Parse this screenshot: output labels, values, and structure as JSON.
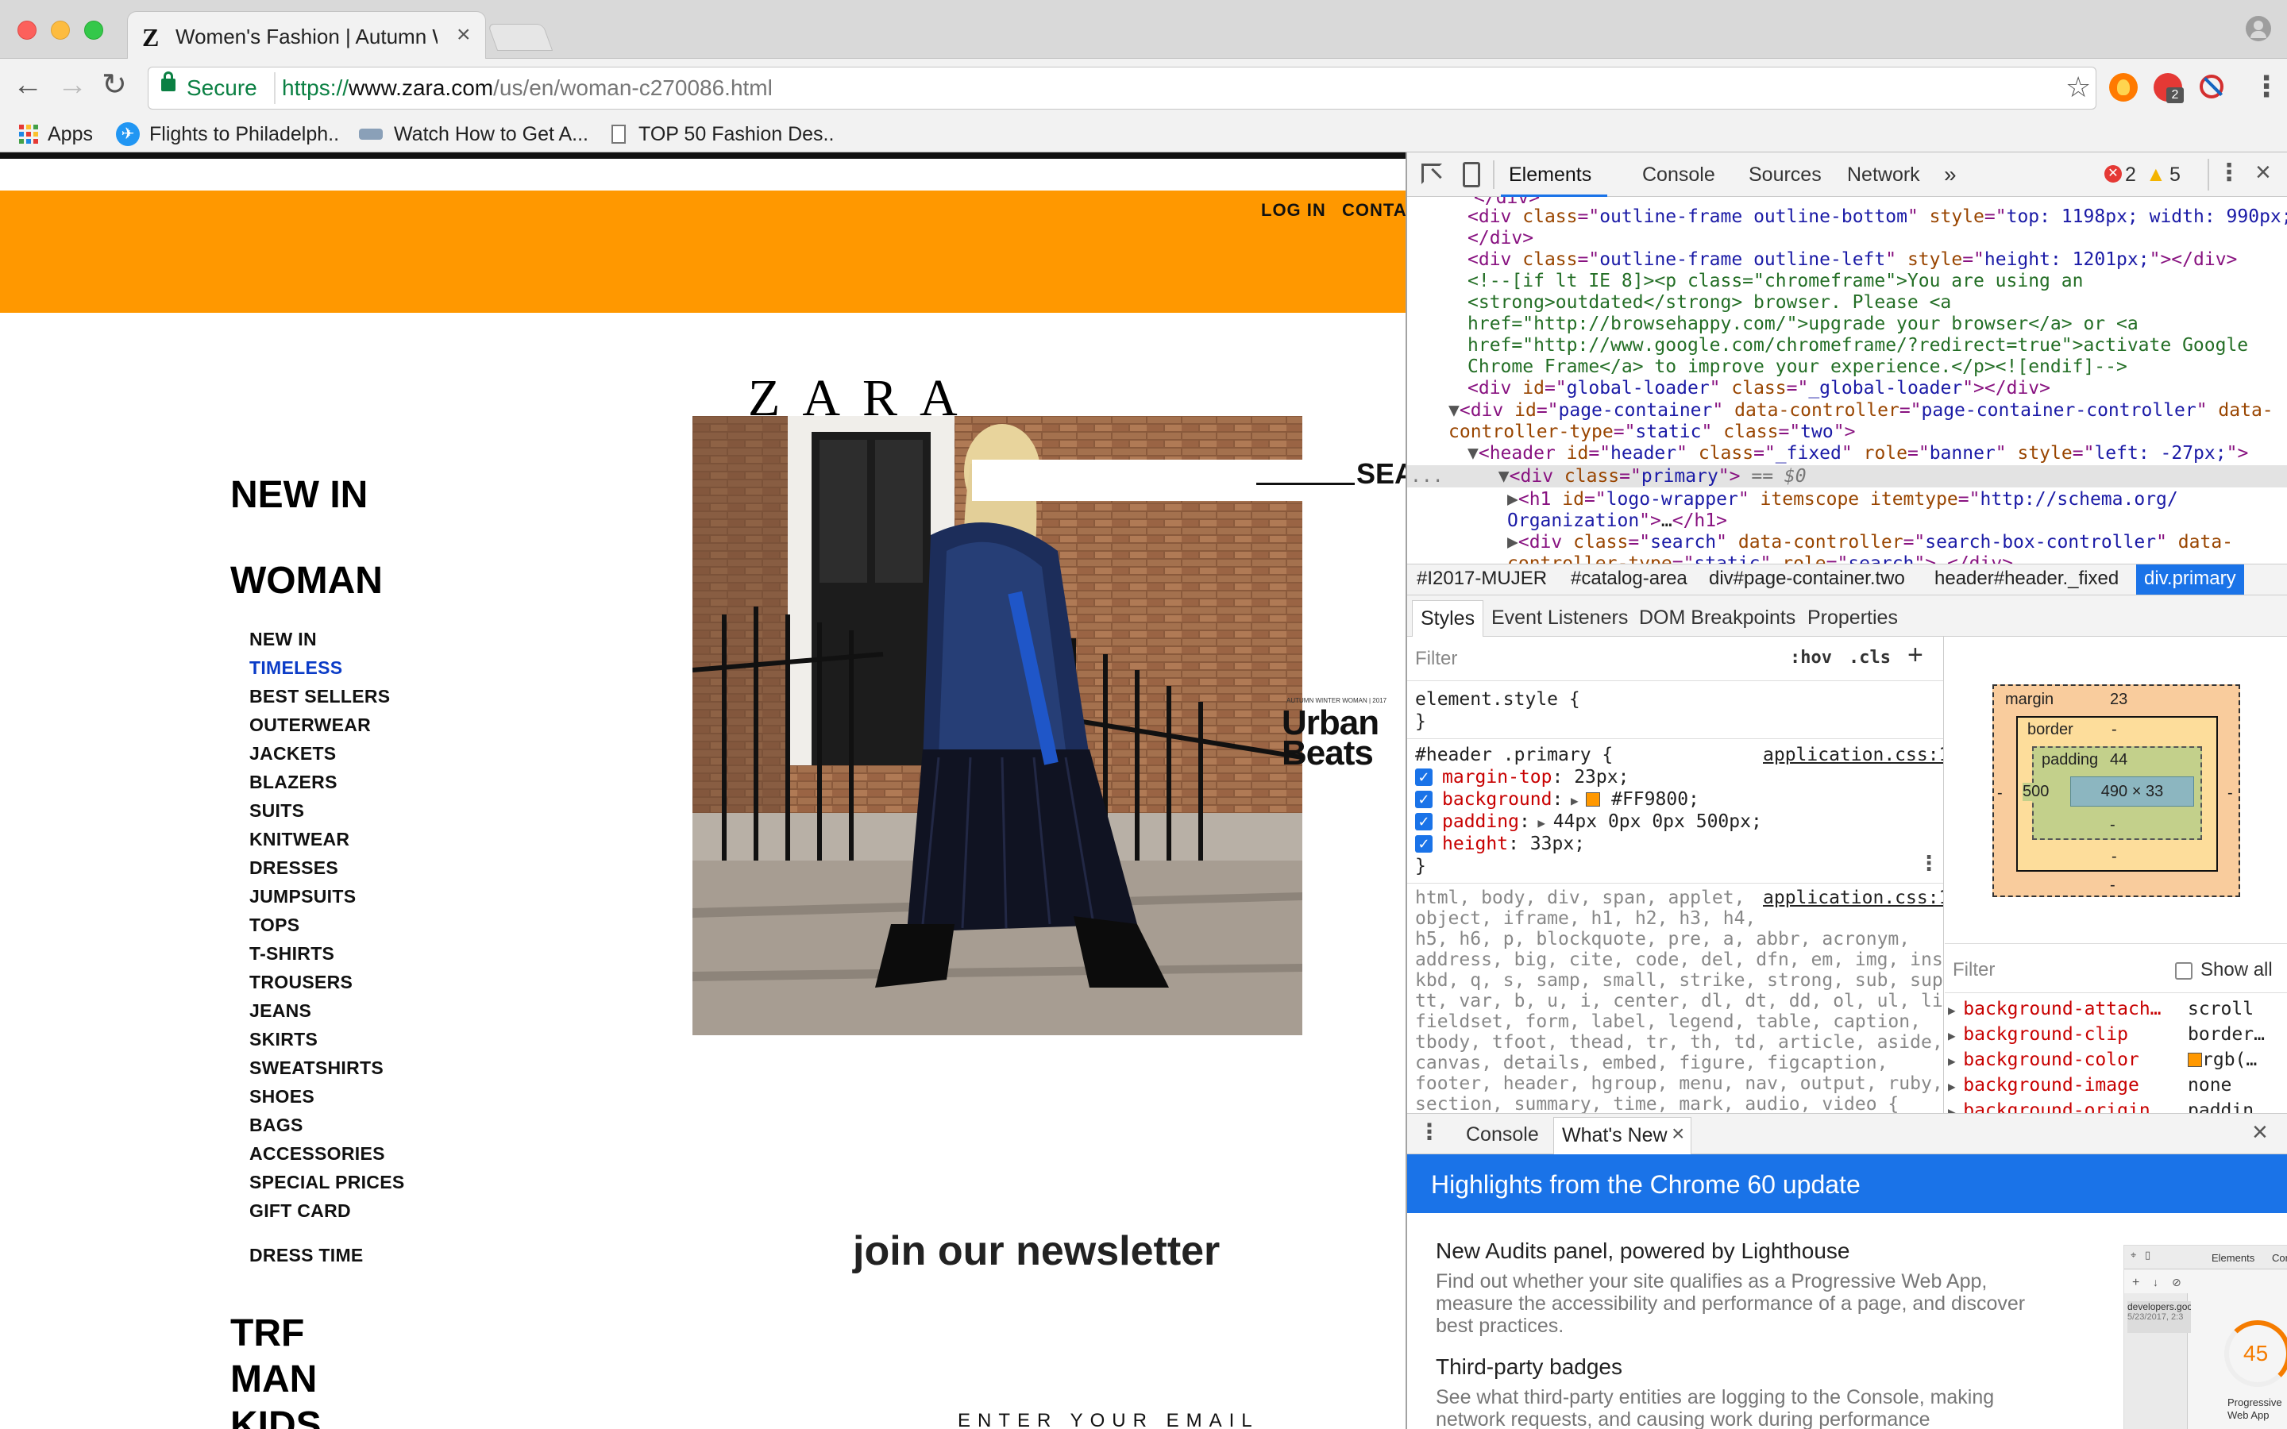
{
  "browser": {
    "tab_title": "Women's Fashion | Autumn Wi",
    "security_label": "Secure",
    "url_scheme": "https://",
    "url_host": "www.zara.com",
    "url_path": "/us/en/woman-c270086.html",
    "bookmarks": [
      {
        "label": "Apps",
        "icon": "apps-grid-icon"
      },
      {
        "label": "Flights to Philadelph..",
        "icon": "plane-icon"
      },
      {
        "label": "Watch How to Get A...",
        "icon": "video-icon"
      },
      {
        "label": "TOP 50 Fashion Des..",
        "icon": "page-icon"
      }
    ],
    "extension_badge": "2"
  },
  "page": {
    "top_links": [
      "LOG IN",
      "CONTAC"
    ],
    "logo": "ZARA",
    "search_label": "SEA",
    "big_nav": [
      "NEW IN",
      "WOMAN"
    ],
    "women_nav": [
      "NEW IN",
      "TIMELESS",
      "BEST SELLERS",
      "OUTERWEAR",
      "JACKETS",
      "BLAZERS",
      "SUITS",
      "KNITWEAR",
      "DRESSES",
      "JUMPSUITS",
      "TOPS",
      "T-SHIRTS",
      "TROUSERS",
      "JEANS",
      "SKIRTS",
      "SWEATSHIRTS",
      "SHOES",
      "BAGS",
      "ACCESSORIES",
      "SPECIAL PRICES",
      "GIFT CARD"
    ],
    "active_nav": "TIMELESS",
    "dress_time": "DRESS TIME",
    "lower_nav": [
      "TRF",
      "MAN",
      "KIDS"
    ],
    "campaign_small": "AUTUMN WINTER WOMAN | 2017",
    "campaign_title_line1": "Urban",
    "campaign_title_line2": "Beats",
    "newsletter": "join our newsletter",
    "email_placeholder": "ENTER YOUR EMAIL",
    "orange_bar_color": "#FF9800"
  },
  "devtools": {
    "tabs": [
      "Elements",
      "Console",
      "Sources",
      "Network"
    ],
    "active_tab": "Elements",
    "errors": "2",
    "warnings": "5",
    "breadcrumbs": [
      "#I2017-MUJER",
      "#catalog-area",
      "div#page-container.two",
      "header#header._fixed",
      "div.primary"
    ],
    "styles_tabs": [
      "Styles",
      "Event Listeners",
      "DOM Breakpoints",
      "Properties"
    ],
    "filter_placeholder": "Filter",
    "hov": ":hov",
    "cls": ".cls",
    "element_style": "element.style {",
    "rule_selector": "#header .primary {",
    "rule_source": "application.css:1",
    "rule_props": [
      {
        "name": "margin-top",
        "value": "23px;"
      },
      {
        "name": "background",
        "value": "#FF9800;"
      },
      {
        "name": "padding",
        "value": "44px 0px 0px 500px;"
      },
      {
        "name": "height",
        "value": "33px;"
      }
    ],
    "reset_selector_lines": [
      "html, body, div, span, applet,",
      "object, iframe, h1, h2, h3, h4,",
      "h5, h6, p, blockquote, pre, a, abbr, acronym,",
      "address, big, cite, code, del, dfn, em, img, ins,",
      "kbd, q, s, samp, small, strike, strong, sub, sup,",
      "tt, var, b, u, i, center, dl, dt, dd, ol, ul, li,",
      "fieldset, form, label, legend, table, caption,",
      "tbody, tfoot, thead, tr, th, td, article, aside,",
      "canvas, details, embed, figure, figcaption,",
      "footer, header, hgroup, menu, nav, output, ruby,",
      "section, summary, time, mark, audio, video {"
    ],
    "box_model": {
      "margin_label": "margin",
      "margin": "23",
      "margin_bottom": "-",
      "border_label": "border",
      "border": "-",
      "border_bottom": "-",
      "padding_label": "padding",
      "padding": "44",
      "padding_left": "500",
      "padding_bottom": "-",
      "content": "490 × 33",
      "side_dash": "-"
    },
    "computed_filter": "Filter",
    "show_all": "Show all",
    "computed": [
      {
        "name": "background-attach…",
        "value": "scroll"
      },
      {
        "name": "background-clip",
        "value": "border…"
      },
      {
        "name": "background-color",
        "value": "rgb(…"
      },
      {
        "name": "background-image",
        "value": "none"
      },
      {
        "name": "background-origin",
        "value": "paddin…"
      }
    ],
    "drawer_tabs": [
      "Console",
      "What's New"
    ],
    "whats_new_title": "Highlights from the Chrome 60 update",
    "items": [
      {
        "title": "New Audits panel, powered by Lighthouse",
        "body": "Find out whether your site qualifies as a Progressive Web App, measure the accessibility and performance of a page, and discover best practices."
      },
      {
        "title": "Third-party badges",
        "body": "See what third-party entities are logging to the Console, making network requests, and causing work during performance"
      }
    ],
    "thumb_tabs": [
      "Elements",
      "Consol"
    ],
    "thumb_url": "developers.goo",
    "thumb_date": "5/23/2017, 2:3",
    "thumb_score": "45",
    "thumb_caption": "Progressive Web App"
  }
}
